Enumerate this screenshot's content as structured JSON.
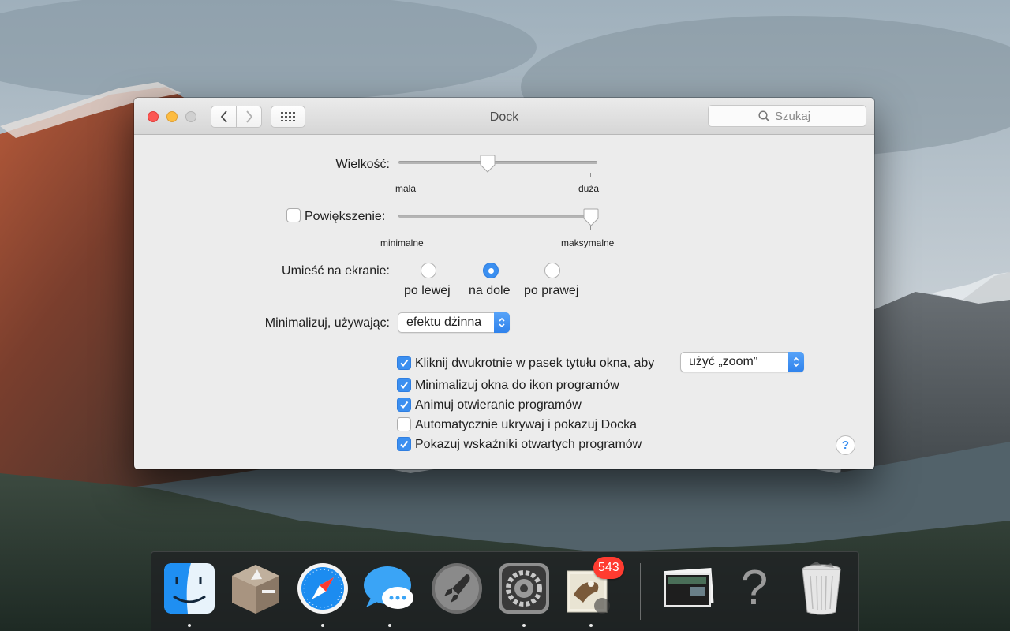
{
  "window": {
    "title": "Dock",
    "search_placeholder": "Szukaj"
  },
  "size": {
    "label": "Wielkość:",
    "min_label": "mała",
    "max_label": "duża",
    "value": 0.44
  },
  "magnification": {
    "label": "Powiększenie:",
    "checked": false,
    "min_label": "minimalne",
    "max_label": "maksymalne",
    "value": 1.0
  },
  "position": {
    "label": "Umieść na ekranie:",
    "options": [
      "po lewej",
      "na dole",
      "po prawej"
    ],
    "selected": "na dole"
  },
  "minimize": {
    "label": "Minimalizuj, używając:",
    "value": "efektu dżinna"
  },
  "options": [
    {
      "label": "Kliknij dwukrotnie w pasek tytułu okna, aby",
      "checked": true
    },
    {
      "label": "Minimalizuj okna do ikon programów",
      "checked": true
    },
    {
      "label": "Animuj otwieranie programów",
      "checked": true
    },
    {
      "label": "Automatycznie ukrywaj i pokazuj Docka",
      "checked": false
    },
    {
      "label": "Pokazuj wskaźniki otwartych programów",
      "checked": true
    }
  ],
  "double_click_action": "użyć „zoom”",
  "help_label": "?",
  "dock": {
    "apps": [
      "finder-icon",
      "archive-utility-icon",
      "safari-icon",
      "messages-icon",
      "launchpad-icon",
      "system-preferences-icon",
      "mail-icon",
      "downloads-stack-icon",
      "question-mark-icon",
      "trash-icon"
    ],
    "mail_badge": "543",
    "unknown_glyph": "?"
  },
  "colors": {
    "accent": "#3b8ff0",
    "badge": "#ff3b30"
  }
}
